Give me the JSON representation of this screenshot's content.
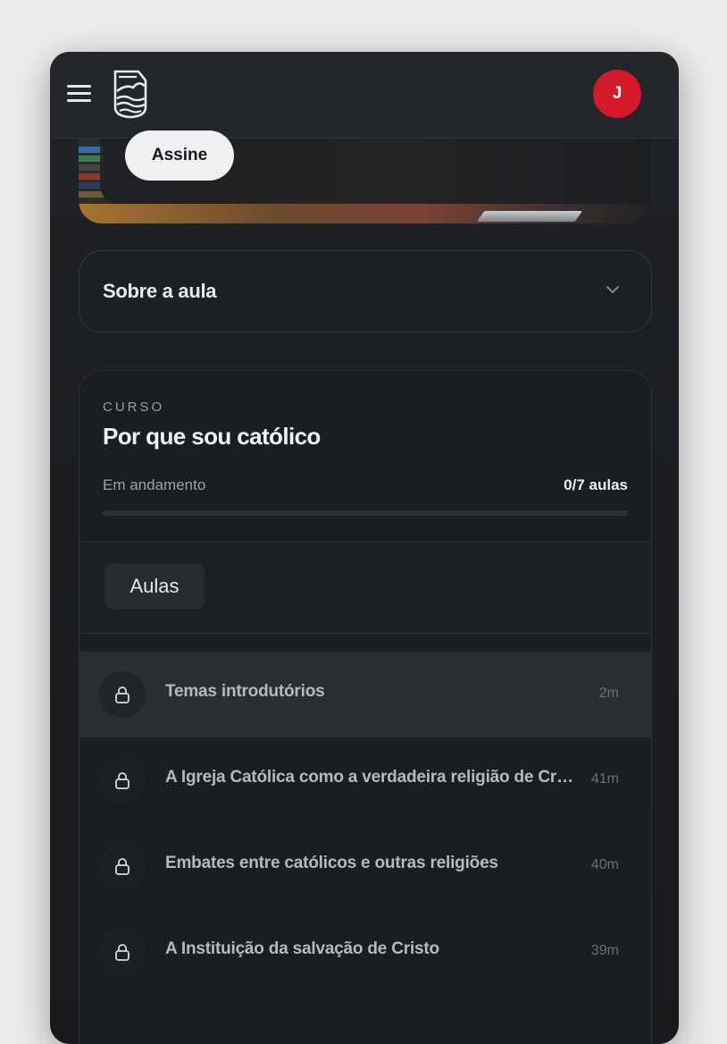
{
  "header": {
    "avatar_initial": "J",
    "accent_color": "#d3192a"
  },
  "hero": {
    "cta_label": "Assine"
  },
  "about": {
    "label": "Sobre a aula"
  },
  "course": {
    "eyebrow": "CURSO",
    "title": "Por que sou católico",
    "status": "Em andamento",
    "count": "0/7 aulas",
    "progress_fraction": 0
  },
  "tabs": {
    "aulas_label": "Aulas"
  },
  "lessons": [
    {
      "title": "Temas introdutórios",
      "duration": "2m"
    },
    {
      "title": "A Igreja Católica como a verdadeira religião de Cristo",
      "duration": "41m"
    },
    {
      "title": "Embates entre católicos e outras religiões",
      "duration": "40m"
    },
    {
      "title": "A Instituição da salvação de Cristo",
      "duration": "39m"
    }
  ],
  "icons": {
    "menu": "menu-icon",
    "logo": "logo-icon",
    "chevron": "chevron-down-icon",
    "lock": "lock-icon"
  }
}
